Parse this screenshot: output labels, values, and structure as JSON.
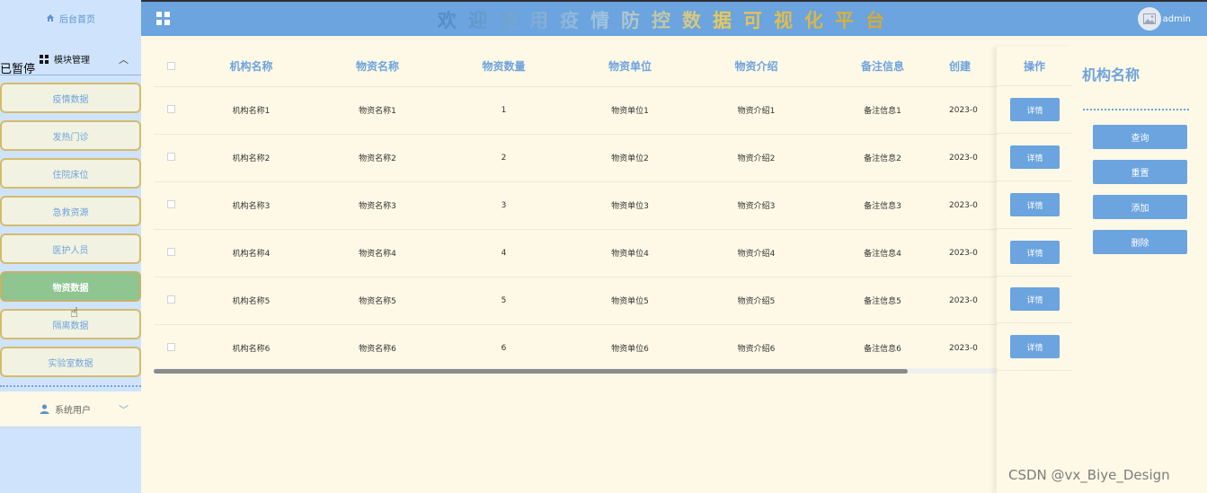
{
  "sidebar": {
    "home_label": "后台首页",
    "module_label": "模块管理",
    "paused_text": "已暂停",
    "items": [
      {
        "label": "疫情数据"
      },
      {
        "label": "发热门诊"
      },
      {
        "label": "住院床位"
      },
      {
        "label": "急救资源"
      },
      {
        "label": "医护人员"
      },
      {
        "label": "物资数据"
      },
      {
        "label": "隔离数据"
      },
      {
        "label": "实验室数据"
      }
    ],
    "active_item": "物资数据",
    "users_label": "系统用户"
  },
  "header": {
    "banner": "欢迎使用疫情防控数据可视化平台",
    "user": "admin"
  },
  "table": {
    "columns": [
      "机构名称",
      "物资名称",
      "物资数量",
      "物资单位",
      "物资介绍",
      "备注信息",
      "创建"
    ],
    "op_header": "操作",
    "rows": [
      {
        "org": "机构名称1",
        "name": "物资名称1",
        "qty": "1",
        "unit": "物资单位1",
        "intro": "物资介绍1",
        "note": "备注信息1",
        "date": "2023-0"
      },
      {
        "org": "机构名称2",
        "name": "物资名称2",
        "qty": "2",
        "unit": "物资单位2",
        "intro": "物资介绍2",
        "note": "备注信息2",
        "date": "2023-0"
      },
      {
        "org": "机构名称3",
        "name": "物资名称3",
        "qty": "3",
        "unit": "物资单位3",
        "intro": "物资介绍3",
        "note": "备注信息3",
        "date": "2023-0"
      },
      {
        "org": "机构名称4",
        "name": "物资名称4",
        "qty": "4",
        "unit": "物资单位4",
        "intro": "物资介绍4",
        "note": "备注信息4",
        "date": "2023-0"
      },
      {
        "org": "机构名称5",
        "name": "物资名称5",
        "qty": "5",
        "unit": "物资单位5",
        "intro": "物资介绍5",
        "note": "备注信息5",
        "date": "2023-0"
      },
      {
        "org": "机构名称6",
        "name": "物资名称6",
        "qty": "6",
        "unit": "物资单位6",
        "intro": "物资介绍6",
        "note": "备注信息6",
        "date": "2023-0"
      }
    ],
    "detail_label": "详情"
  },
  "search": {
    "title": "机构名称",
    "query_label": "查询",
    "reset_label": "重置",
    "add_label": "添加",
    "delete_label": "删除"
  },
  "watermark": "CSDN @vx_Biye_Design",
  "icons": {
    "home": "home-icon",
    "module": "grid-icon",
    "users": "user-icon",
    "menu": "menu-grid-icon",
    "avatar": "image-icon",
    "cursor": "hand-pointer-icon"
  },
  "colors": {
    "primary": "#6ba4de",
    "sidebar_bg": "#cfe4fc",
    "active_item": "#8ec590",
    "page_bg": "#fdf9e6",
    "menu_border": "#d4bb6e"
  }
}
